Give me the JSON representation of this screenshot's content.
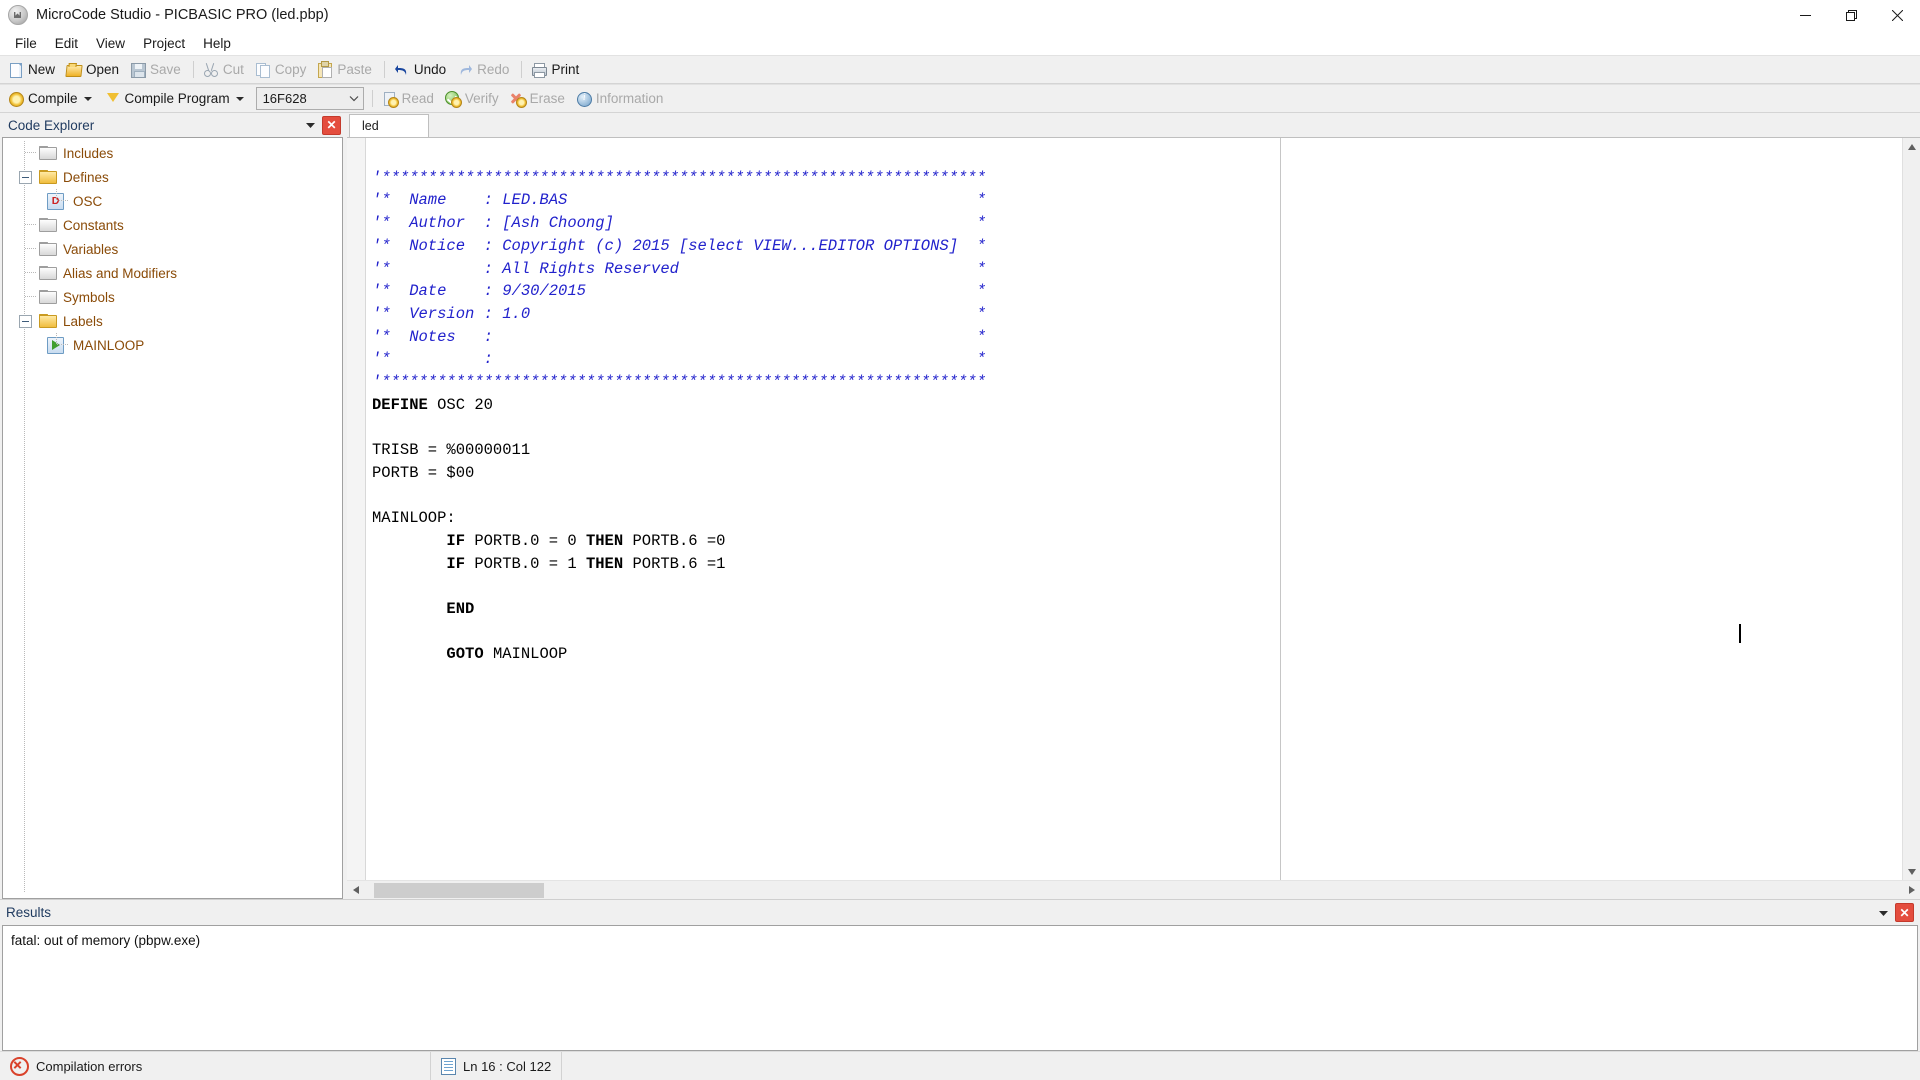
{
  "window": {
    "title": "MicroCode Studio - PICBASIC PRO (led.pbp)",
    "app_icon": "app-logo-icon",
    "minimize": "—",
    "maximize": "❐",
    "close": "✕"
  },
  "menubar": {
    "items": [
      {
        "label": "File"
      },
      {
        "label": "Edit"
      },
      {
        "label": "View"
      },
      {
        "label": "Project"
      },
      {
        "label": "Help"
      }
    ]
  },
  "toolbar_file": {
    "items": [
      {
        "label": "New",
        "icon": "new-document-icon",
        "disabled": false
      },
      {
        "label": "Open",
        "icon": "open-folder-icon",
        "disabled": false
      },
      {
        "label": "Save",
        "icon": "save-disk-icon",
        "disabled": true
      },
      {
        "label": "Cut",
        "icon": "cut-scissors-icon",
        "disabled": true
      },
      {
        "label": "Copy",
        "icon": "copy-pages-icon",
        "disabled": true
      },
      {
        "label": "Paste",
        "icon": "paste-clipboard-icon",
        "disabled": true
      },
      {
        "label": "Undo",
        "icon": "undo-arrow-icon",
        "disabled": false
      },
      {
        "label": "Redo",
        "icon": "redo-arrow-icon",
        "disabled": true
      },
      {
        "label": "Print",
        "icon": "printer-icon",
        "disabled": false
      }
    ]
  },
  "toolbar_compile": {
    "compile": {
      "label": "Compile",
      "icon": "compile-gear-icon"
    },
    "compile_program": {
      "label": "Compile Program",
      "icon": "compile-program-arrow-icon"
    },
    "device_combo": {
      "value": "16F628",
      "icon": "chevron-down-icon"
    },
    "items": [
      {
        "label": "Read",
        "icon": "read-chip-icon",
        "disabled": true
      },
      {
        "label": "Verify",
        "icon": "verify-check-icon",
        "disabled": true
      },
      {
        "label": "Erase",
        "icon": "erase-x-icon",
        "disabled": true
      },
      {
        "label": "Information",
        "icon": "information-icon",
        "disabled": true
      }
    ]
  },
  "explorer": {
    "title": "Code Explorer",
    "menu_icon": "chevron-down-icon",
    "close_icon": "close-icon",
    "close_label": "✕",
    "nodes": [
      {
        "label": "Includes",
        "type": "folder",
        "level": 1,
        "expanded": false
      },
      {
        "label": "Defines",
        "type": "folder-open",
        "level": 1,
        "expanded": true
      },
      {
        "label": "OSC",
        "type": "define",
        "level": 2,
        "badge": "D"
      },
      {
        "label": "Constants",
        "type": "folder",
        "level": 1,
        "expanded": false
      },
      {
        "label": "Variables",
        "type": "folder",
        "level": 1,
        "expanded": false
      },
      {
        "label": "Alias and Modifiers",
        "type": "folder",
        "level": 1,
        "expanded": false
      },
      {
        "label": "Symbols",
        "type": "folder",
        "level": 1,
        "expanded": false
      },
      {
        "label": "Labels",
        "type": "folder-open",
        "level": 1,
        "expanded": true
      },
      {
        "label": "MAINLOOP",
        "type": "label",
        "level": 2
      }
    ]
  },
  "editor": {
    "tabs": [
      {
        "label": "led",
        "active": true
      }
    ],
    "code_lines": [
      {
        "text": "'*****************************************************************",
        "style": "comment"
      },
      {
        "text": "'*  Name    : LED.BAS                                            *",
        "style": "comment"
      },
      {
        "text": "'*  Author  : [Ash Choong]                                       *",
        "style": "comment"
      },
      {
        "text": "'*  Notice  : Copyright (c) 2015 [select VIEW...EDITOR OPTIONS]  *",
        "style": "comment"
      },
      {
        "text": "'*          : All Rights Reserved                                *",
        "style": "comment"
      },
      {
        "text": "'*  Date    : 9/30/2015                                          *",
        "style": "comment"
      },
      {
        "text": "'*  Version : 1.0                                                *",
        "style": "comment"
      },
      {
        "text": "'*  Notes   :                                                    *",
        "style": "comment"
      },
      {
        "text": "'*          :                                                    *",
        "style": "comment"
      },
      {
        "text": "'*****************************************************************",
        "style": "comment"
      },
      {
        "text": "DEFINE OSC 20",
        "style": "code",
        "keyword": "DEFINE"
      },
      {
        "text": "",
        "style": "code"
      },
      {
        "text": "TRISB = %00000011",
        "style": "code"
      },
      {
        "text": "PORTB = $00",
        "style": "code"
      },
      {
        "text": "",
        "style": "code"
      },
      {
        "text": "MAINLOOP:",
        "style": "code"
      },
      {
        "text": "        IF PORTB.0 = 0 THEN PORTB.6 =0",
        "style": "code"
      },
      {
        "text": "        IF PORTB.0 = 1 THEN PORTB.6 =1",
        "style": "code"
      },
      {
        "text": "",
        "style": "code"
      },
      {
        "text": "        END",
        "style": "code",
        "keyword": "END"
      },
      {
        "text": "",
        "style": "code"
      },
      {
        "text": "        GOTO MAINLOOP",
        "style": "code",
        "keyword": "GOTO"
      }
    ],
    "scroll_left_icon": "scroll-left-icon",
    "scroll_right_icon": "scroll-right-icon",
    "scroll_up_icon": "scroll-up-icon",
    "scroll_down_icon": "scroll-down-icon"
  },
  "results": {
    "title": "Results",
    "menu_icon": "chevron-down-icon",
    "close_icon": "close-icon",
    "close_label": "✕",
    "output": "fatal: out of memory (pbpw.exe)"
  },
  "statusbar": {
    "compile_status": "Compilation errors",
    "status_icon": "error-circle-icon",
    "position": "Ln 16 : Col 122",
    "position_icon": "cursor-position-icon"
  },
  "colors": {
    "comment_blue": "#2222cc",
    "tree_text": "#8a4b08",
    "panel_title": "#1f3a5f",
    "error_red": "#d9422b",
    "close_button_red": "#e44d3e"
  }
}
